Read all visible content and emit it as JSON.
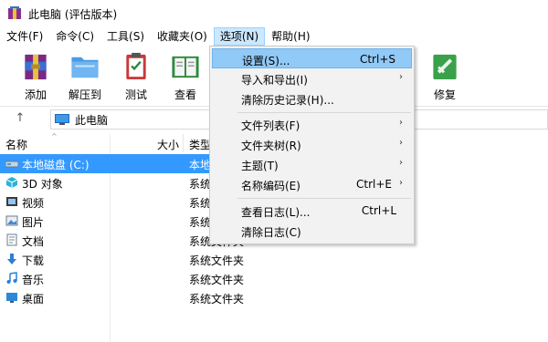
{
  "window": {
    "title": "此电脑 (评估版本)"
  },
  "menubar": {
    "items": [
      "文件(F)",
      "命令(C)",
      "工具(S)",
      "收藏夹(O)",
      "选项(N)",
      "帮助(H)"
    ]
  },
  "toolbar": {
    "buttons": [
      {
        "label": "添加",
        "icon": "add-archive-icon"
      },
      {
        "label": "解压到",
        "icon": "extract-folder-icon"
      },
      {
        "label": "测试",
        "icon": "test-clipboard-icon"
      },
      {
        "label": "查看",
        "icon": "view-book-icon"
      },
      {
        "label": "修复",
        "icon": "repair-kit-icon"
      }
    ]
  },
  "address": {
    "path": "此电脑"
  },
  "columns": {
    "name": "名称",
    "size": "大小",
    "type": "类型"
  },
  "files": [
    {
      "name": "本地磁盘 (C:)",
      "type": "本地磁盘",
      "icon": "drive-icon",
      "selected": true
    },
    {
      "name": "3D 对象",
      "type": "系统文件夹",
      "icon": "3d-objects-icon"
    },
    {
      "name": "视频",
      "type": "系统文件夹",
      "icon": "video-icon"
    },
    {
      "name": "图片",
      "type": "系统文件夹",
      "icon": "pictures-icon"
    },
    {
      "name": "文档",
      "type": "系统文件夹",
      "icon": "documents-icon"
    },
    {
      "name": "下载",
      "type": "系统文件夹",
      "icon": "downloads-icon"
    },
    {
      "name": "音乐",
      "type": "系统文件夹",
      "icon": "music-icon"
    },
    {
      "name": "桌面",
      "type": "系统文件夹",
      "icon": "desktop-icon"
    }
  ],
  "options_menu": {
    "items": [
      {
        "label": "设置(S)...",
        "shortcut": "Ctrl+S",
        "highlighted": true
      },
      {
        "label": "导入和导出(I)",
        "submenu": true
      },
      {
        "label": "清除历史记录(H)..."
      },
      {
        "label": "文件列表(F)",
        "submenu": true
      },
      {
        "label": "文件夹树(R)",
        "submenu": true
      },
      {
        "label": "主题(T)",
        "submenu": true
      },
      {
        "label": "名称编码(E)",
        "shortcut": "Ctrl+E",
        "submenu": true
      },
      {
        "label": "查看日志(L)...",
        "shortcut": "Ctrl+L"
      },
      {
        "label": "清除日志(C)"
      }
    ],
    "submenu_glyph": "›"
  },
  "colors": {
    "selection": "#3399ff",
    "menu_highlight": "#91c9f7",
    "menubar_active": "#cce8ff"
  }
}
